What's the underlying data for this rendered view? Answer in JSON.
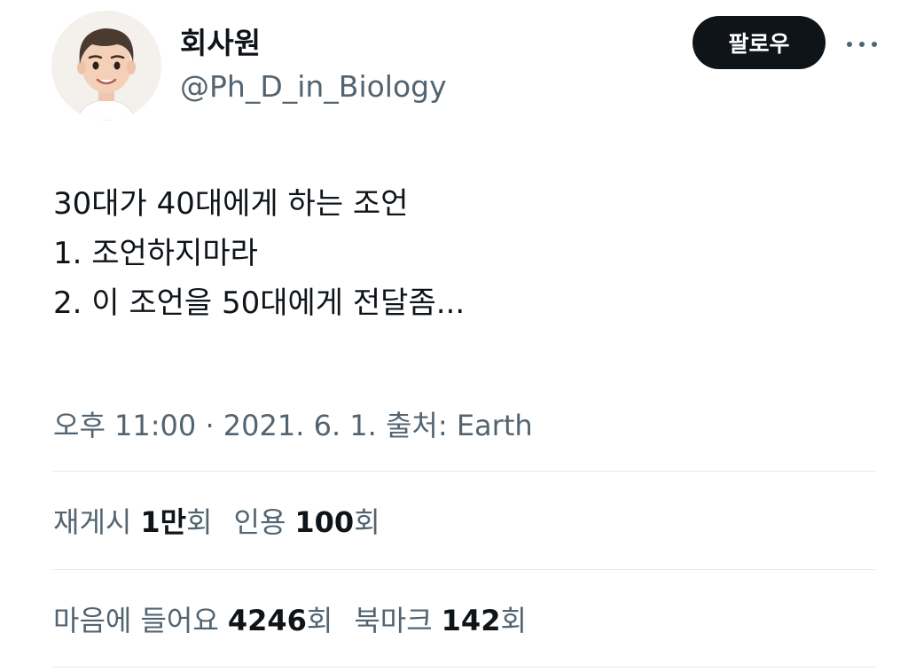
{
  "author": {
    "display_name": "회사원",
    "handle": "@Ph_D_in_Biology",
    "avatar_icon": "cartoon-avatar"
  },
  "actions": {
    "follow_label": "팔로우",
    "more_icon": "more-horizontal-icon"
  },
  "tweet": {
    "lines": [
      "30대가 40대에게 하는 조언",
      "1. 조언하지마라",
      "2. 이 조언을 50대에게 전달좀..."
    ]
  },
  "meta": {
    "time": "오후 11:00",
    "separator": " · ",
    "date": "2021. 6. 1.",
    "source_label": "출처:",
    "source": "Earth"
  },
  "stats": {
    "retweets": {
      "label": "재게시",
      "count": "1만",
      "unit": "회"
    },
    "quotes": {
      "label": "인용",
      "count": "100",
      "unit": "회"
    },
    "likes": {
      "label": "마음에 들어요",
      "count": "4246",
      "unit": "회"
    },
    "bookmarks": {
      "label": "북마크",
      "count": "142",
      "unit": "회"
    }
  },
  "colors": {
    "text_primary": "#0f1419",
    "text_secondary": "#536471",
    "button_bg": "#0f1419",
    "divider": "#e6e9ec"
  }
}
